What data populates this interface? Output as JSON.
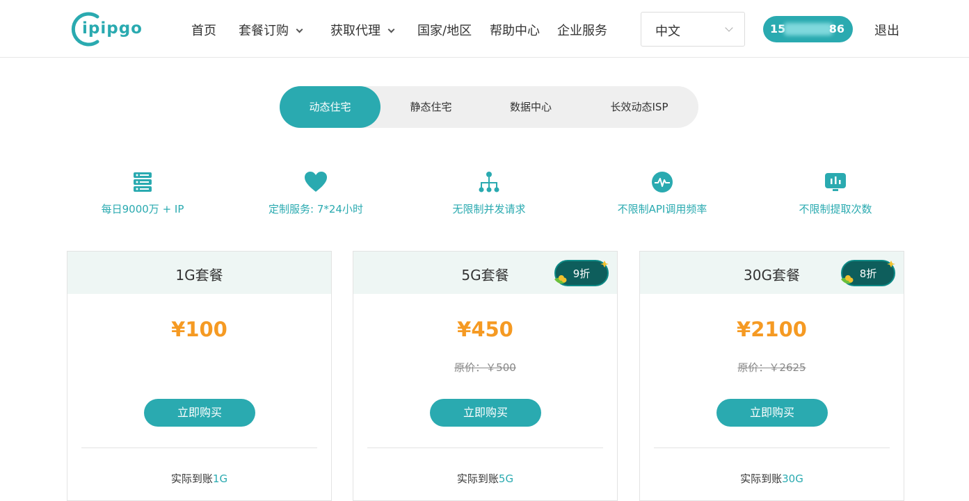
{
  "header": {
    "logo_text": "ipipgo",
    "nav": [
      {
        "label": "首页",
        "has_dropdown": false
      },
      {
        "label": "套餐订购",
        "has_dropdown": true
      },
      {
        "label": "获取代理",
        "has_dropdown": true
      },
      {
        "label": "国家/地区",
        "has_dropdown": false
      },
      {
        "label": "帮助中心",
        "has_dropdown": false
      },
      {
        "label": "企业服务",
        "has_dropdown": false
      }
    ],
    "language": "中文",
    "user_prefix": "15",
    "user_suffix": "86",
    "logout": "退出"
  },
  "tabs": [
    {
      "label": "动态住宅",
      "active": true
    },
    {
      "label": "静态住宅",
      "active": false
    },
    {
      "label": "数据中心",
      "active": false
    },
    {
      "label": "长效动态ISP",
      "active": false
    }
  ],
  "features": [
    {
      "icon": "server-icon",
      "label": "每日9000万 + IP"
    },
    {
      "icon": "heart-icon",
      "label": "定制服务: 7*24小时"
    },
    {
      "icon": "sitemap-icon",
      "label": "无限制并发请求"
    },
    {
      "icon": "pulse-icon",
      "label": "不限制API调用频率"
    },
    {
      "icon": "chart-monitor-icon",
      "label": "不限制提取次数"
    }
  ],
  "plans": [
    {
      "title": "1G套餐",
      "price": "¥100",
      "original": "",
      "badge": "",
      "buy": "立即购买",
      "arrive_label": "实际到账",
      "arrive_value": "1G"
    },
    {
      "title": "5G套餐",
      "price": "¥450",
      "original": "原价：￥500",
      "badge": "9折",
      "buy": "立即购买",
      "arrive_label": "实际到账",
      "arrive_value": "5G"
    },
    {
      "title": "30G套餐",
      "price": "¥2100",
      "original": "原价：￥2625",
      "badge": "8折",
      "buy": "立即购买",
      "arrive_label": "实际到账",
      "arrive_value": "30G"
    }
  ],
  "colors": {
    "brand": "#2aaab0",
    "price": "#f59a23",
    "badge": "#0e5e5c"
  }
}
